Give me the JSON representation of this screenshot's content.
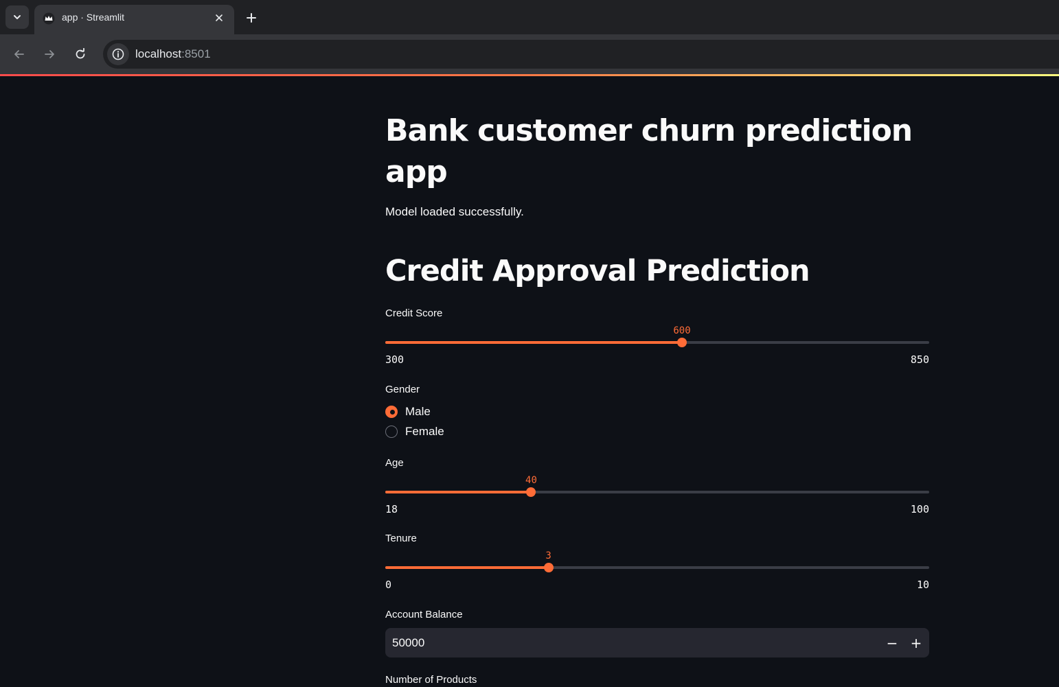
{
  "browser": {
    "tab_title": "app · Streamlit",
    "tab_favicon": "streamlit-crown-icon",
    "url_host": "localhost",
    "url_port": ":8501"
  },
  "app": {
    "title": "Bank customer churn prediction app",
    "status": "Model loaded successfully.",
    "section_heading": "Credit Approval Prediction",
    "accent_color": "#ff6c37",
    "credit_score": {
      "label": "Credit Score",
      "value": 600,
      "min": 300,
      "max": 850
    },
    "gender": {
      "label": "Gender",
      "options": [
        "Male",
        "Female"
      ],
      "selected": "Male"
    },
    "age": {
      "label": "Age",
      "value": 40,
      "min": 18,
      "max": 100
    },
    "tenure": {
      "label": "Tenure",
      "value": 3,
      "min": 0,
      "max": 10
    },
    "account_balance": {
      "label": "Account Balance",
      "value": "50000",
      "decrement": "−",
      "increment": "+"
    },
    "num_products": {
      "label": "Number of Products"
    }
  }
}
